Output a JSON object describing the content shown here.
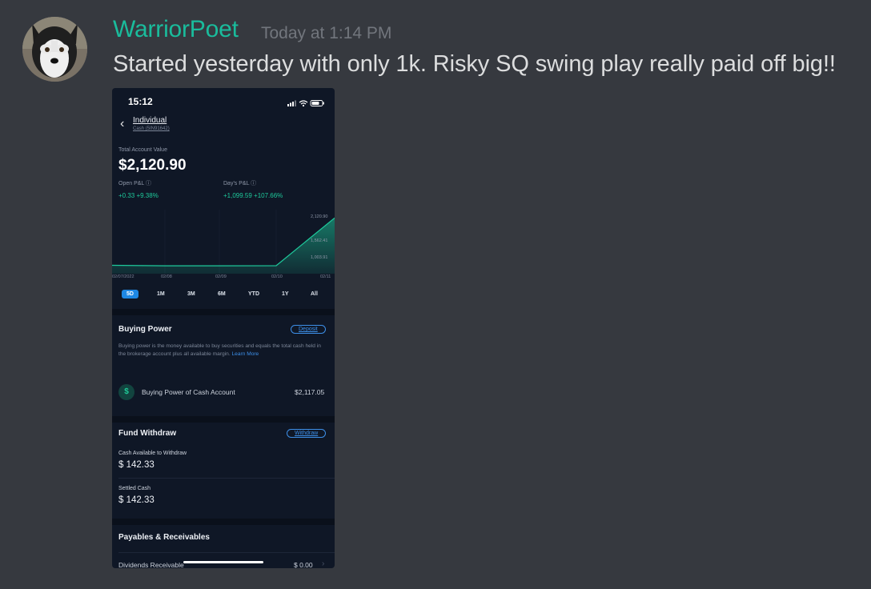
{
  "message": {
    "username": "WarriorPoet",
    "timestamp": "Today at 1:14 PM",
    "text": "Started yesterday with only 1k. Risky SQ swing play really paid off big!!"
  },
  "phone": {
    "status_time": "15:12",
    "account_name": "Individual",
    "account_sub": "Cash (5IN91642)",
    "total_value_label": "Total Account Value",
    "total_value": "$2,120.90",
    "open_pl_label": "Open P&L ⓘ",
    "open_pl_value": "+0.33 +9.38%",
    "day_pl_label": "Day's P&L ⓘ",
    "day_pl_value": "+1,099.59 +107.66%",
    "tabs": [
      "5D",
      "1M",
      "3M",
      "6M",
      "YTD",
      "1Y",
      "All"
    ],
    "active_tab": "5D",
    "buying_power": {
      "title": "Buying Power",
      "button": "Deposit",
      "desc": "Buying power is the money available to buy securities and equals the total cash held in the brokerage account plus all available margin.",
      "learn_more": "Learn More",
      "row_label": "Buying Power of Cash Account",
      "row_value": "$2,117.05"
    },
    "fund_withdraw": {
      "title": "Fund Withdraw",
      "button": "Withdraw",
      "cash_label": "Cash Available to Withdraw",
      "cash_value": "$ 142.33",
      "settled_label": "Settled Cash",
      "settled_value": "$ 142.33"
    },
    "payables": {
      "title": "Payables & Receivables",
      "row_label": "Dividends Receivable",
      "row_value": "$ 0.00"
    }
  },
  "chart_data": {
    "type": "area",
    "x": [
      "02/07/2022",
      "02/08",
      "02/09",
      "02/10",
      "02/11"
    ],
    "values": [
      1021.31,
      1010,
      1010,
      1012,
      2120.9
    ],
    "ytick_labels": [
      "2,120.90",
      "1,562.41",
      "1,003.91"
    ],
    "ylim": [
      900,
      2200
    ],
    "color": "#1ec99b"
  }
}
